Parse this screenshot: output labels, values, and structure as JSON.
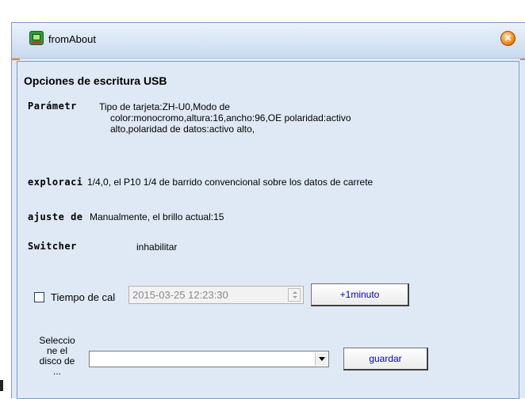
{
  "window": {
    "title": "fromAbout",
    "close_symbol": "✕"
  },
  "section": {
    "heading": "Opciones de escritura USB"
  },
  "parametro": {
    "label": "Parámetr",
    "value_lines": [
      "Tipo de tarjeta:ZH-U0,Modo de",
      "color:monocromo,altura:16,ancho:96,OE  polaridad:activo",
      "alto,polaridad de datos:activo alto,"
    ]
  },
  "exploracion": {
    "label": "exploraci",
    "value": "1/4,0, el P10 1/4 de barrido convencional sobre los datos de carrete"
  },
  "ajuste": {
    "label": "ajuste de",
    "value": "Manualmente, el brillo actual:15"
  },
  "switcher": {
    "label": "Switcher",
    "value": "inhabilitar"
  },
  "tiempo": {
    "checkbox_label": "Tiempo de cal",
    "checked": false,
    "datetime_value": "2015-03-25  12:23:30",
    "plus_button_label": "+1minuto"
  },
  "disk": {
    "label_lines": [
      "Seleccio",
      "ne el",
      "disco de",
      "..."
    ],
    "selected_value": "",
    "save_button_label": "guardar"
  },
  "colors": {
    "window_bg": "#dfe9f6",
    "border": "#7a9cc4",
    "accent_orange": "#e8852a",
    "button_text": "#0000cc"
  }
}
